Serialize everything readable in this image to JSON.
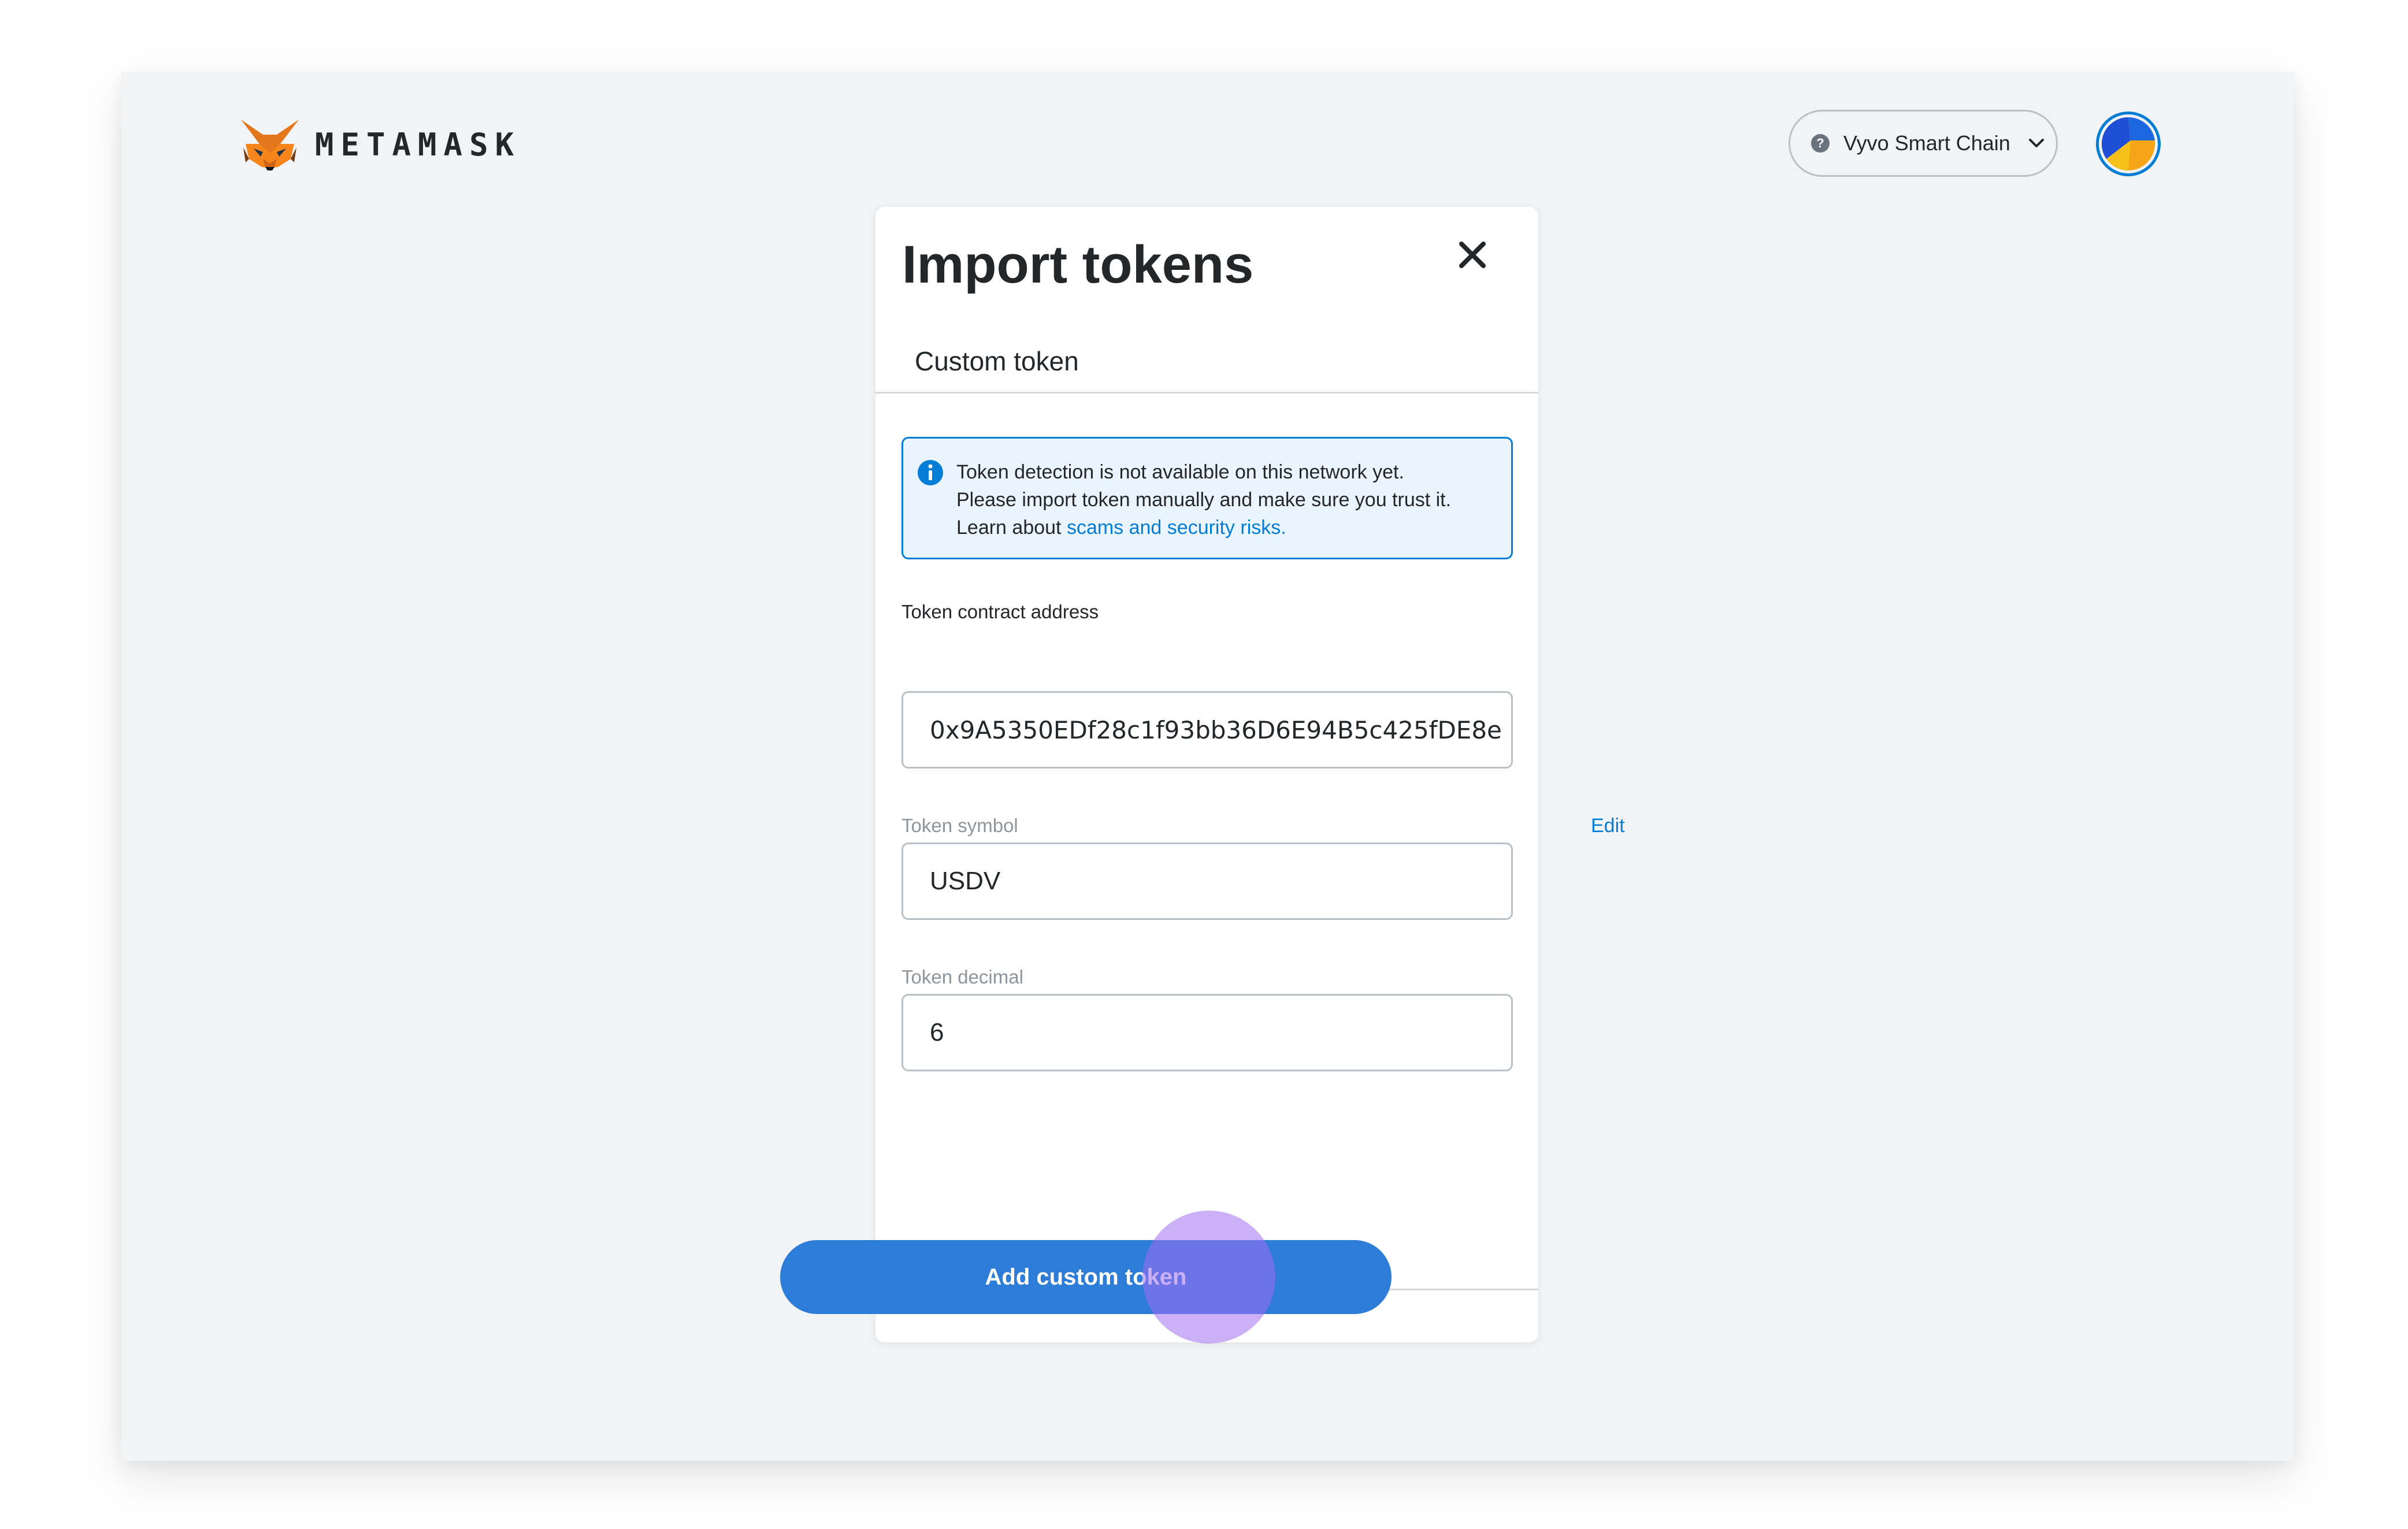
{
  "header": {
    "brand": "METAMASK",
    "network": {
      "name": "Vyvo Smart Chain",
      "icon": "question-icon"
    },
    "avatar": "account-avatar"
  },
  "modal": {
    "title": "Import tokens",
    "close_icon": "close-icon",
    "tab_label": "Custom token",
    "notice": {
      "icon": "info-icon",
      "line1": "Token detection is not available on this network yet.",
      "line2": "Please import token manually and make sure you trust it.",
      "line3_prefix": "Learn about ",
      "line3_link": "scams and security risks."
    },
    "contract_address": {
      "label": "Token contract address",
      "value": "0x9A5350EDf28c1f93bb36D6E94B5c425fDE8e"
    },
    "token_symbol": {
      "label": "Token symbol",
      "edit_label": "Edit",
      "value": "USDV"
    },
    "token_decimal": {
      "label": "Token decimal",
      "value": "6"
    },
    "submit_label": "Add custom token"
  },
  "colors": {
    "accent": "#037dd6",
    "button": "#2d7cd8",
    "background": "#f2f3f4",
    "text": "#24272a",
    "click_indicator": "#a06ef0"
  }
}
